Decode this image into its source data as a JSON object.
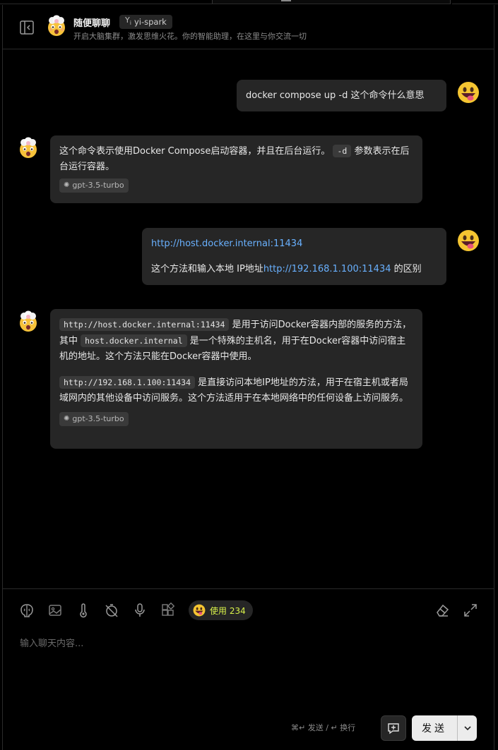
{
  "header": {
    "title": "随便聊聊",
    "model_badge": "yi-spark",
    "subtitle": "开启大脑集群，激发思维火花。你的智能助理，在这里与你交流一切"
  },
  "messages": [
    {
      "role": "user",
      "text": "docker compose up -d 这个命令什么意思"
    },
    {
      "role": "assistant",
      "text_before": "这个命令表示使用Docker Compose启动容器，并且在后台运行。",
      "code": "-d",
      "text_after": "参数表示在后台运行容器。",
      "model_tag": "gpt-3.5-turbo"
    },
    {
      "role": "user",
      "link": "http://host.docker.internal:11434",
      "line2_before": "这个方法和输入本地 IP地址",
      "line2_link": "http://192.168.1.100:11434",
      "line2_after": "的区别"
    },
    {
      "role": "assistant",
      "p1_code1": "http://host.docker.internal:11434",
      "p1_text1": "是用于访问Docker容器内部的服务的方法，其中",
      "p1_code2": "host.docker.internal",
      "p1_text2": "是一个特殊的主机名，用于在Docker容器中访问宿主机的地址。这个方法只能在Docker容器中使用。",
      "p2_code": "http://192.168.1.100:11434",
      "p2_text": "是直接访问本地IP地址的方法，用于在宿主机或者局域网内的其他设备中访问服务。这个方法适用于在本地网络中的任何设备上访问服务。",
      "model_tag": "gpt-3.5-turbo"
    }
  ],
  "input": {
    "usage_label": "使用 234",
    "placeholder": "输入聊天内容...",
    "shortcut_hint": "⌘↵ 发送 / ↵ 换行",
    "send_label": "发送"
  },
  "icons": {
    "toolbar": [
      "brain-icon",
      "image-icon",
      "thermometer-icon",
      "timer-off-icon",
      "microphone-icon",
      "plugin-icon",
      "eraser-icon",
      "expand-icon"
    ]
  },
  "colors": {
    "link": "#69b1ff",
    "usage_text": "#d9f24a",
    "bubble_bg": "#262626"
  }
}
